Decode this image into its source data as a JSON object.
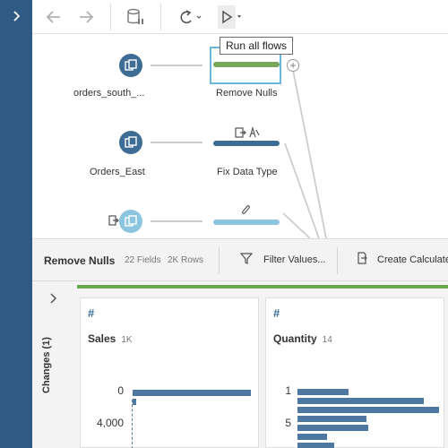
{
  "toolbar": {
    "buttons": [
      "back-icon",
      "forward-icon",
      "database-pause-icon",
      "refresh-icon",
      "run-icon"
    ]
  },
  "tooltip": {
    "text": "Run all flows"
  },
  "flow": {
    "inputs": [
      {
        "label": "orders_south_..."
      },
      {
        "label": "Orders_East"
      },
      {
        "label": ""
      }
    ],
    "steps": [
      {
        "label": "Remove Nulls",
        "color": "#79a85a"
      },
      {
        "label": "Fix Data Type",
        "color": "#3d6d94"
      },
      {
        "label": "",
        "color": "#8cc5df"
      }
    ]
  },
  "profile": {
    "title": "Remove Nulls",
    "fields": "22 Fields",
    "rows": "2K Rows",
    "actions": [
      {
        "label": "Filter Values..."
      },
      {
        "label": "Create Calculated"
      }
    ]
  },
  "changes": {
    "label": "Changes (1)"
  },
  "cards": [
    {
      "name": "Sales",
      "count": "1K",
      "ticks": [
        "0",
        "4,000"
      ],
      "bars": [
        1.0,
        0.03
      ]
    },
    {
      "name": "Quantity",
      "count": "14",
      "ticks": [
        "1",
        "5"
      ],
      "bars": [
        0.36,
        0.89,
        1.0,
        0.49,
        0.5,
        0.21,
        0.26
      ]
    }
  ],
  "colors": {
    "sidebar": "#2f5a84",
    "accent_green": "#6aa84f",
    "node": "#3d6d94",
    "bar": "#4f78a0"
  }
}
